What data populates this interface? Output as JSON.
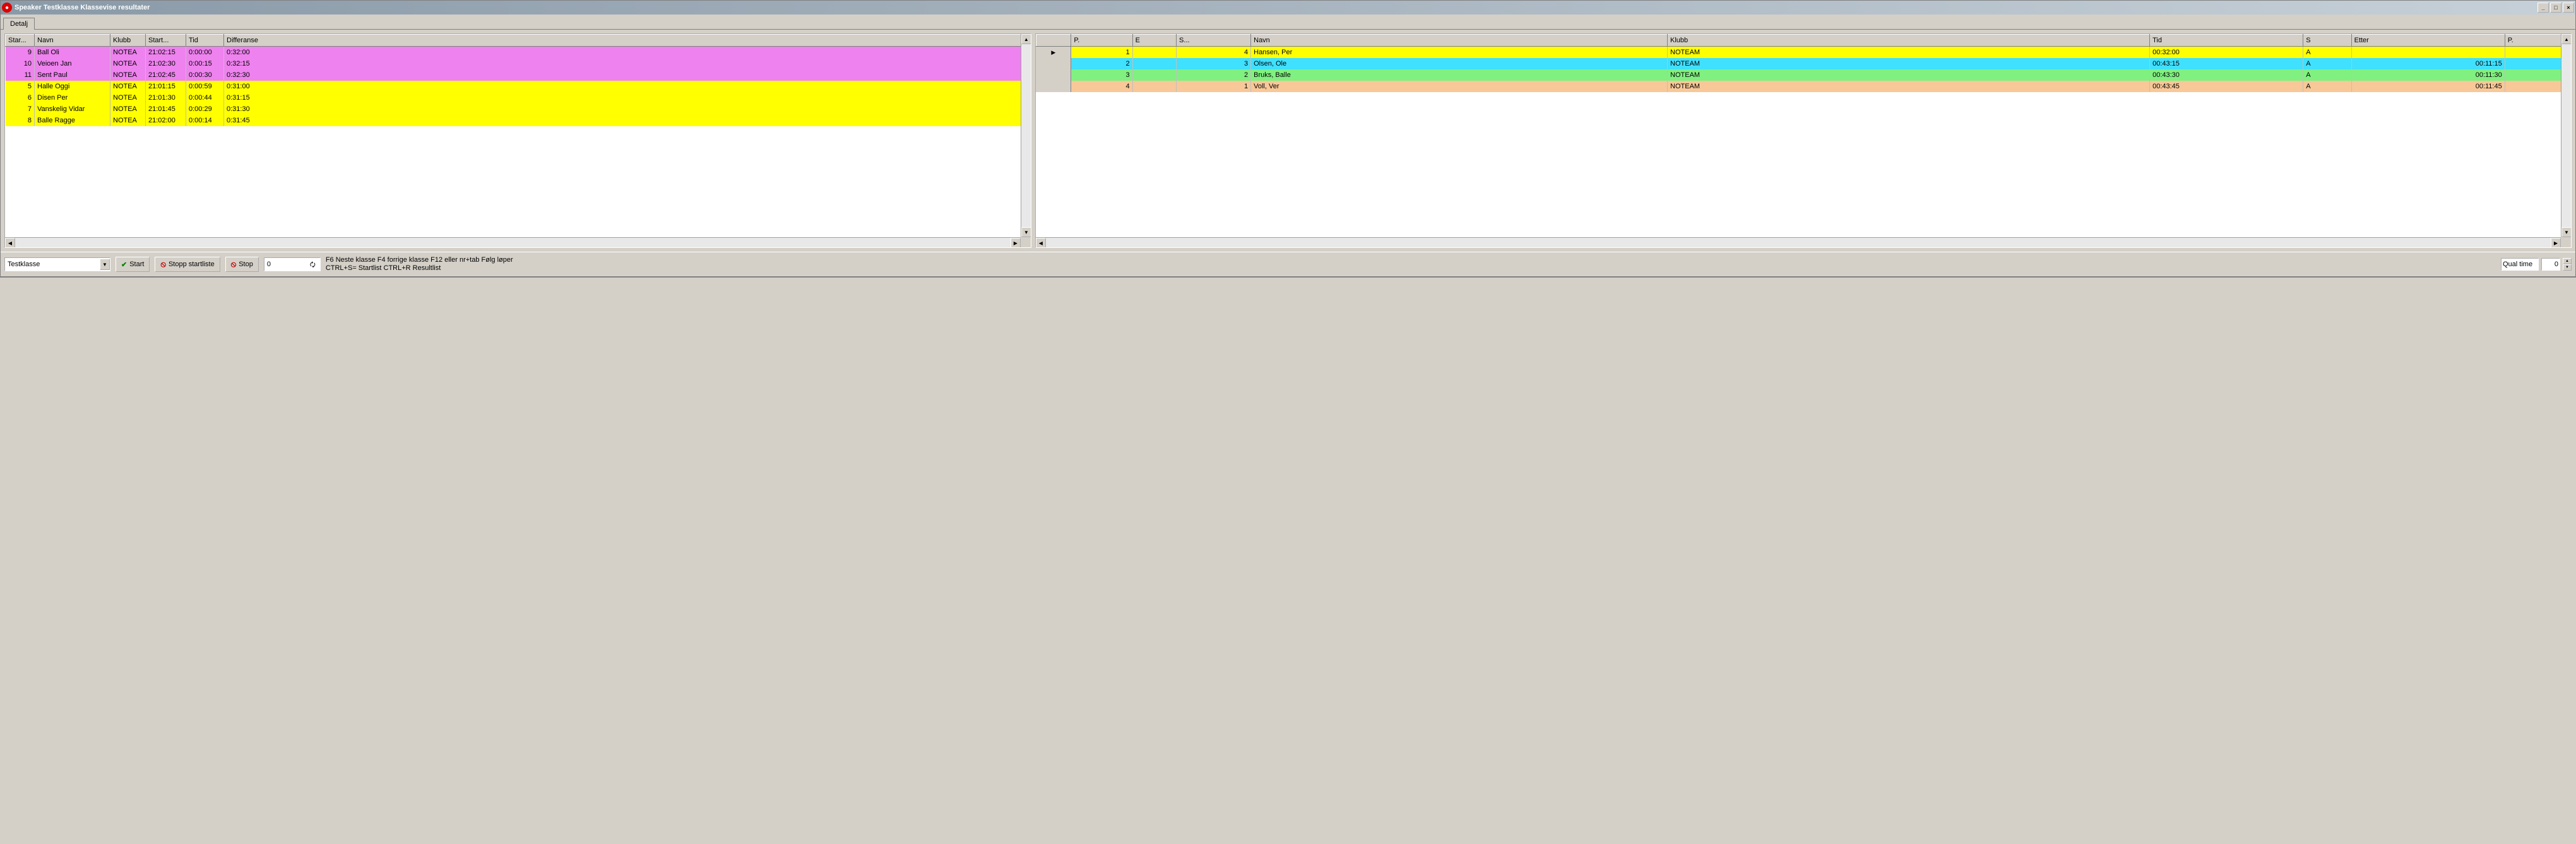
{
  "window": {
    "title": "Speaker  Testklasse Klassevise resultater",
    "tab": "Detalj"
  },
  "left": {
    "columns": [
      "Star...",
      "Navn",
      "Klubb",
      "Start...",
      "Tid",
      "Differanse"
    ],
    "rows": [
      {
        "color": "magenta",
        "start": "9",
        "navn": "Ball Oli",
        "klubb": "NOTEA",
        "starttid": "21:02:15",
        "tid": "0:00:00",
        "diff": "0:32:00"
      },
      {
        "color": "magenta",
        "start": "10",
        "navn": "Veioen Jan",
        "klubb": "NOTEA",
        "starttid": "21:02:30",
        "tid": "0:00:15",
        "diff": "0:32:15"
      },
      {
        "color": "magenta",
        "start": "11",
        "navn": "Sent Paul",
        "klubb": "NOTEA",
        "starttid": "21:02:45",
        "tid": "0:00:30",
        "diff": "0:32:30"
      },
      {
        "color": "yellow",
        "start": "5",
        "navn": "Halle Oggi",
        "klubb": "NOTEA",
        "starttid": "21:01:15",
        "tid": "0:00:59",
        "diff": "0:31:00"
      },
      {
        "color": "yellow",
        "start": "6",
        "navn": "Disen Per",
        "klubb": "NOTEA",
        "starttid": "21:01:30",
        "tid": "0:00:44",
        "diff": "0:31:15"
      },
      {
        "color": "yellow",
        "start": "7",
        "navn": "Vanskelig Vidar",
        "klubb": "NOTEA",
        "starttid": "21:01:45",
        "tid": "0:00:29",
        "diff": "0:31:30"
      },
      {
        "color": "yellow",
        "start": "8",
        "navn": "Balle Ragge",
        "klubb": "NOTEA",
        "starttid": "21:02:00",
        "tid": "0:00:14",
        "diff": "0:31:45"
      }
    ]
  },
  "right": {
    "columns": [
      "",
      "P.",
      "E",
      "S...",
      "Navn",
      "Klubb",
      "Tid",
      "S",
      "Etter",
      "P."
    ],
    "rows": [
      {
        "color": "yellow",
        "marker": "▶",
        "p": "1",
        "e": "",
        "s": "4",
        "navn": "Hansen, Per",
        "klubb": "NOTEAM",
        "tid": "00:32:00",
        "stat": "A",
        "etter": "",
        "p2": ""
      },
      {
        "color": "cyan",
        "marker": "",
        "p": "2",
        "e": "",
        "s": "3",
        "navn": "Olsen, Ole",
        "klubb": "NOTEAM",
        "tid": "00:43:15",
        "stat": "A",
        "etter": "00:11:15",
        "p2": ""
      },
      {
        "color": "green",
        "marker": "",
        "p": "3",
        "e": "",
        "s": "2",
        "navn": "Bruks, Balle",
        "klubb": "NOTEAM",
        "tid": "00:43:30",
        "stat": "A",
        "etter": "00:11:30",
        "p2": ""
      },
      {
        "color": "orange",
        "marker": "",
        "p": "4",
        "e": "",
        "s": "1",
        "navn": "Voll, Ver",
        "klubb": "NOTEAM",
        "tid": "00:43:45",
        "stat": "A",
        "etter": "00:11:45",
        "p2": ""
      }
    ]
  },
  "toolbar": {
    "combo_value": "Testklasse",
    "start_label": "Start",
    "stop_startliste_label": "Stopp startliste",
    "stop_label": "Stop",
    "numbox_value": "0",
    "hint_line1": "F6 Neste klasse F4 forrige klasse  F12 eller nr+tab Følg løper",
    "hint_line2": "CTRL+S= Startlist  CTRL+R Resultlist",
    "qual_label": "Qual time",
    "qual_value": "0"
  }
}
